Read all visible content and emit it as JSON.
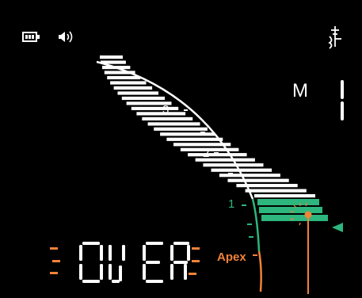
{
  "status_bar": {
    "battery_icon": "battery-icon",
    "speaker_icon": "speaker-icon",
    "antenna_icon": "tooth-antenna-icon"
  },
  "mode": {
    "letter": "M",
    "number": "1"
  },
  "scale": {
    "ticks": [
      {
        "label": "3",
        "color": "#ffffff"
      },
      {
        "label": "2",
        "color": "#ffffff"
      },
      {
        "label": "1",
        "color": "#2db67d"
      }
    ]
  },
  "status": {
    "text": "OVER",
    "apex_label": "Apex"
  },
  "colors": {
    "background": "#000000",
    "white_bars": "#ffffff",
    "green_zone": "#2db67d",
    "orange": "#f0823a"
  }
}
